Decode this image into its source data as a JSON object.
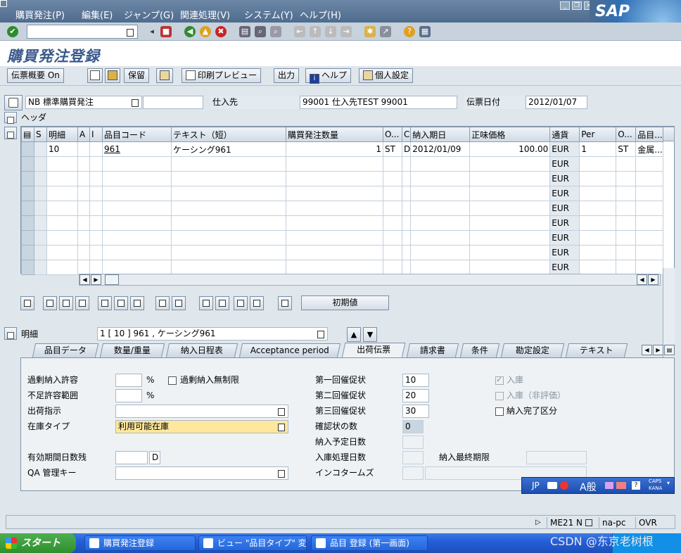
{
  "menu": {
    "items": [
      "購買発注(P)",
      "編集(E)",
      "ジャンプ(G)",
      "関連処理(V)",
      "システム(Y)",
      "ヘルプ(H)"
    ],
    "logo": "SAP"
  },
  "title": "購買発注登録",
  "app_toolbar": {
    "doc_overview": "伝票概要 On",
    "hold": "保留",
    "print_preview": "印刷プレビュー",
    "messages": "出力",
    "help": "ヘルプ",
    "personal": "個人設定"
  },
  "header": {
    "doc_type": "NB 標準購買発注",
    "vendor_label": "仕入先",
    "vendor_value": "99001 仕入先TEST 99001",
    "doc_date_label": "伝票日付",
    "doc_date_value": "2012/01/07",
    "header_label": "ヘッダ"
  },
  "grid": {
    "columns": [
      "S",
      "明細",
      "A",
      "I",
      "品目コード",
      "テキスト（短）",
      "購買発注数量",
      "O...",
      "C",
      "納入期日",
      "正味価格",
      "通貨",
      "Per",
      "O...",
      "品目..."
    ],
    "rows": [
      {
        "item": "10",
        "material": "961",
        "text": "ケーシング961",
        "qty": "1",
        "unit": "ST",
        "cat": "D",
        "date": "2012/01/09",
        "price": "100.00",
        "currency": "EUR",
        "per": "1",
        "oun": "ST",
        "group": "金属..."
      },
      {
        "currency": "EUR"
      },
      {
        "currency": "EUR"
      },
      {
        "currency": "EUR"
      },
      {
        "currency": "EUR"
      },
      {
        "currency": "EUR"
      },
      {
        "currency": "EUR"
      },
      {
        "currency": "EUR"
      },
      {
        "currency": "EUR"
      }
    ]
  },
  "defaults_button": "初期値",
  "item_detail": {
    "label": "明細",
    "selector": "1 [ 10 ] 961 , ケーシング961"
  },
  "tabs": [
    "品目データ",
    "数量/重量",
    "納入日程表",
    "Acceptance period",
    "出荷伝票",
    "請求書",
    "条件",
    "勘定設定",
    "テキスト"
  ],
  "active_tab": "出荷伝票",
  "panel": {
    "overdelivery_label": "過剰納入許容",
    "pct": "%",
    "unlimited_label": "過剰納入無制限",
    "underdelivery_label": "不足許容範囲",
    "shipping_instr_label": "出荷指示",
    "stock_type_label": "在庫タイプ",
    "stock_type_value": "利用可能在庫",
    "shelf_life_label": "有効期間日数残",
    "shelf_life_unit": "D",
    "qa_key_label": "QA 管理キー",
    "rem1_label": "第一回催促状",
    "rem1": "10",
    "rem2_label": "第二回催促状",
    "rem2": "20",
    "rem3_label": "第三回催促状",
    "rem3": "30",
    "ack_label": "確認状の数",
    "ack": "0",
    "planned_days_label": "納入予定日数",
    "gr_days_label": "入庫処理日数",
    "last_delivery_label": "納入最終期限",
    "incoterms_label": "インコタームズ",
    "gr_label": "入庫",
    "gr_nonval_label": "入庫（非評価）",
    "delivery_complete_label": "納入完了区分"
  },
  "ime": {
    "lang": "JP",
    "mode": "A般",
    "caps": "CAPS",
    "kana": "KANA"
  },
  "status": {
    "tcode": "ME21 N",
    "host": "na-pc",
    "mode": "OVR"
  },
  "taskbar": {
    "start": "スタート",
    "tasks": [
      "購買発注登録",
      "ビュー \"品目タイプ\" 変...",
      "品目 登録 (第一画面)"
    ]
  },
  "watermark": "CSDN @东京老树根"
}
